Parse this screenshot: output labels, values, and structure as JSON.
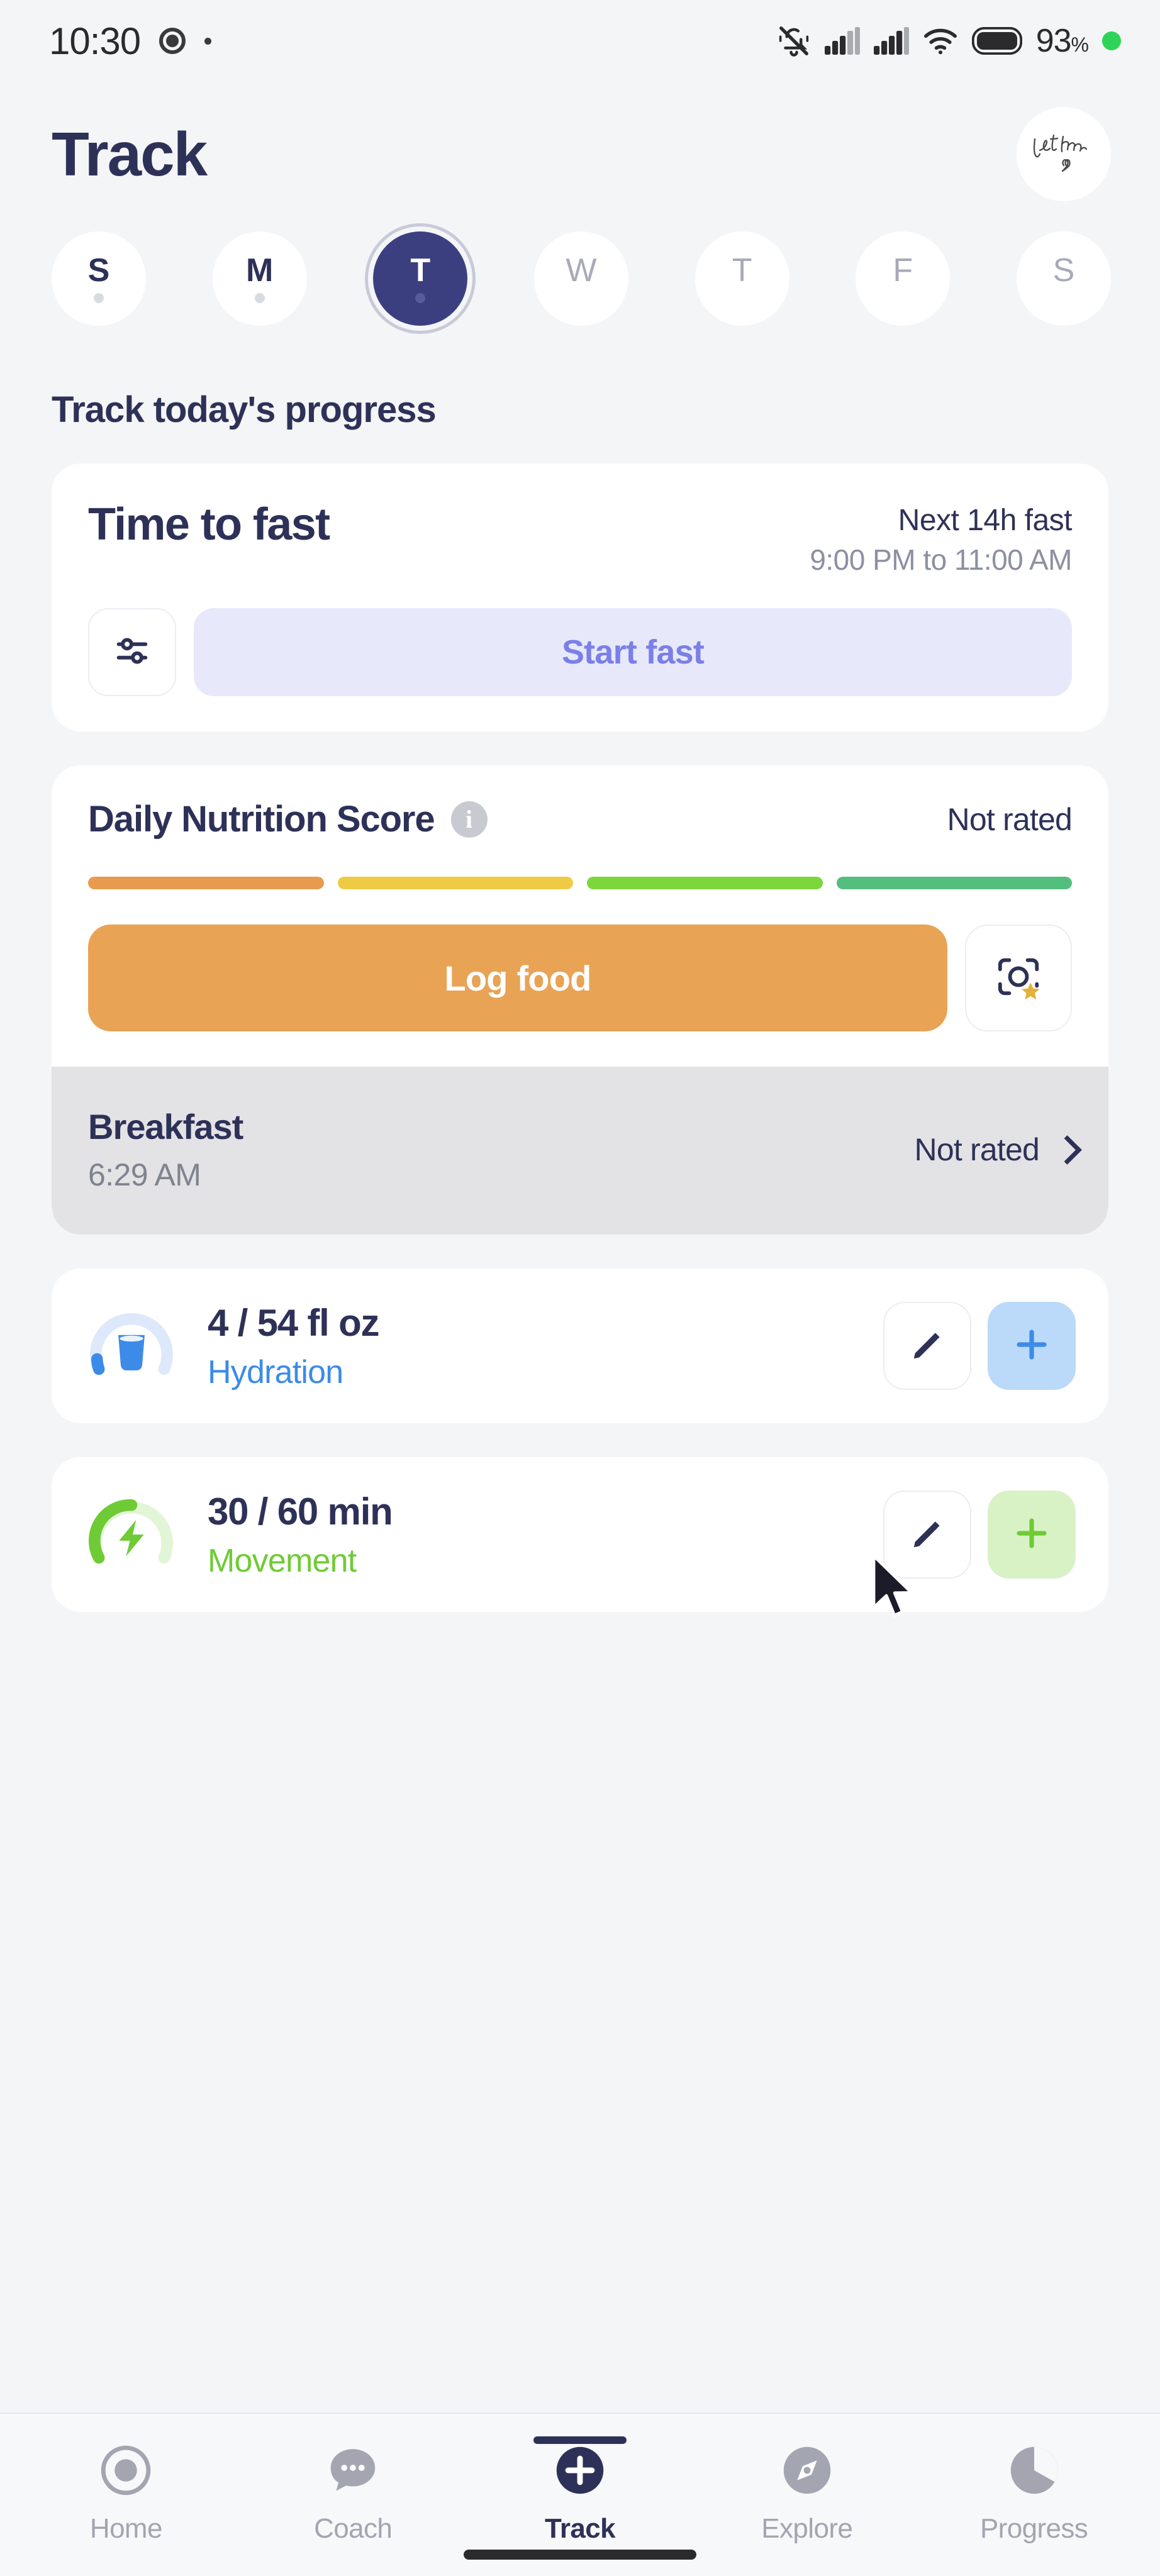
{
  "status_bar": {
    "time": "10:30",
    "icons": [
      "record-icon",
      "dot-icon",
      "mute-bell-icon",
      "signal-1-icon",
      "signal-2-icon",
      "wifi-icon",
      "battery-icon"
    ],
    "battery_percent": "93",
    "percent_symbol": "%"
  },
  "header": {
    "title": "Track",
    "avatar_line1": "Let them",
    "avatar_icon": "heart-icon"
  },
  "week": {
    "days": [
      {
        "letter": "S",
        "state": "past"
      },
      {
        "letter": "M",
        "state": "past"
      },
      {
        "letter": "T",
        "state": "selected"
      },
      {
        "letter": "W",
        "state": "future"
      },
      {
        "letter": "T",
        "state": "future"
      },
      {
        "letter": "F",
        "state": "future"
      },
      {
        "letter": "S",
        "state": "future"
      }
    ]
  },
  "section": {
    "title": "Track today's progress"
  },
  "fasting": {
    "title": "Time to fast",
    "next_label": "Next 14h fast",
    "window": "9:00 PM to 11:00 AM",
    "settings_icon": "sliders-icon",
    "start_label": "Start fast",
    "start_bg": "#E7E8FA",
    "start_text_color": "#7B7FE8"
  },
  "nutrition": {
    "title": "Daily Nutrition Score",
    "info_icon": "info-icon",
    "info_glyph": "i",
    "status": "Not rated",
    "segments": [
      {
        "name": "segment-poor",
        "color": "#E89A4F"
      },
      {
        "name": "segment-fair",
        "color": "#EFCB45"
      },
      {
        "name": "segment-good",
        "color": "#7CD63C"
      },
      {
        "name": "segment-great",
        "color": "#53BE7E"
      }
    ],
    "log_food_label": "Log food",
    "log_food_bg": "#E9A355",
    "scan_icon": "camera-scan-star-icon",
    "meal": {
      "name": "Breakfast",
      "time": "6:29 AM",
      "status": "Not rated",
      "chevron_icon": "chevron-right-icon"
    }
  },
  "metrics": [
    {
      "icon": "water-glass-icon",
      "value": "4 / 54 fl oz",
      "label": "Hydration",
      "label_color": "#3C8BE8",
      "ring_color": "#3C8BE8",
      "ring_track": "#DDE9FB",
      "progress_percent": 7,
      "edit_icon": "pencil-icon",
      "add_icon": "plus-icon",
      "add_bg": "#BBD9F8",
      "add_color": "#3C8BE8"
    },
    {
      "icon": "lightning-bolt-icon",
      "value": "30 / 60 min",
      "label": "Movement",
      "label_color": "#6FCB35",
      "ring_color": "#6FCB35",
      "ring_track": "#E2F5D6",
      "progress_percent": 50,
      "edit_icon": "pencil-icon",
      "add_icon": "plus-icon",
      "add_bg": "#D8F2C6",
      "add_color": "#6FCB35"
    }
  ],
  "bottom_nav": {
    "items": [
      {
        "label": "Home",
        "icon": "target-circle-icon",
        "active": false
      },
      {
        "label": "Coach",
        "icon": "chat-bubble-dots-icon",
        "active": false
      },
      {
        "label": "Track",
        "icon": "plus-circle-icon",
        "active": true
      },
      {
        "label": "Explore",
        "icon": "compass-icon",
        "active": false
      },
      {
        "label": "Progress",
        "icon": "pie-chart-icon",
        "active": false
      }
    ]
  },
  "theme": {
    "background": "#F4F5F7",
    "card": "#FFFFFF",
    "primary_navy": "#2E3157",
    "muted": "#8D90A1"
  }
}
